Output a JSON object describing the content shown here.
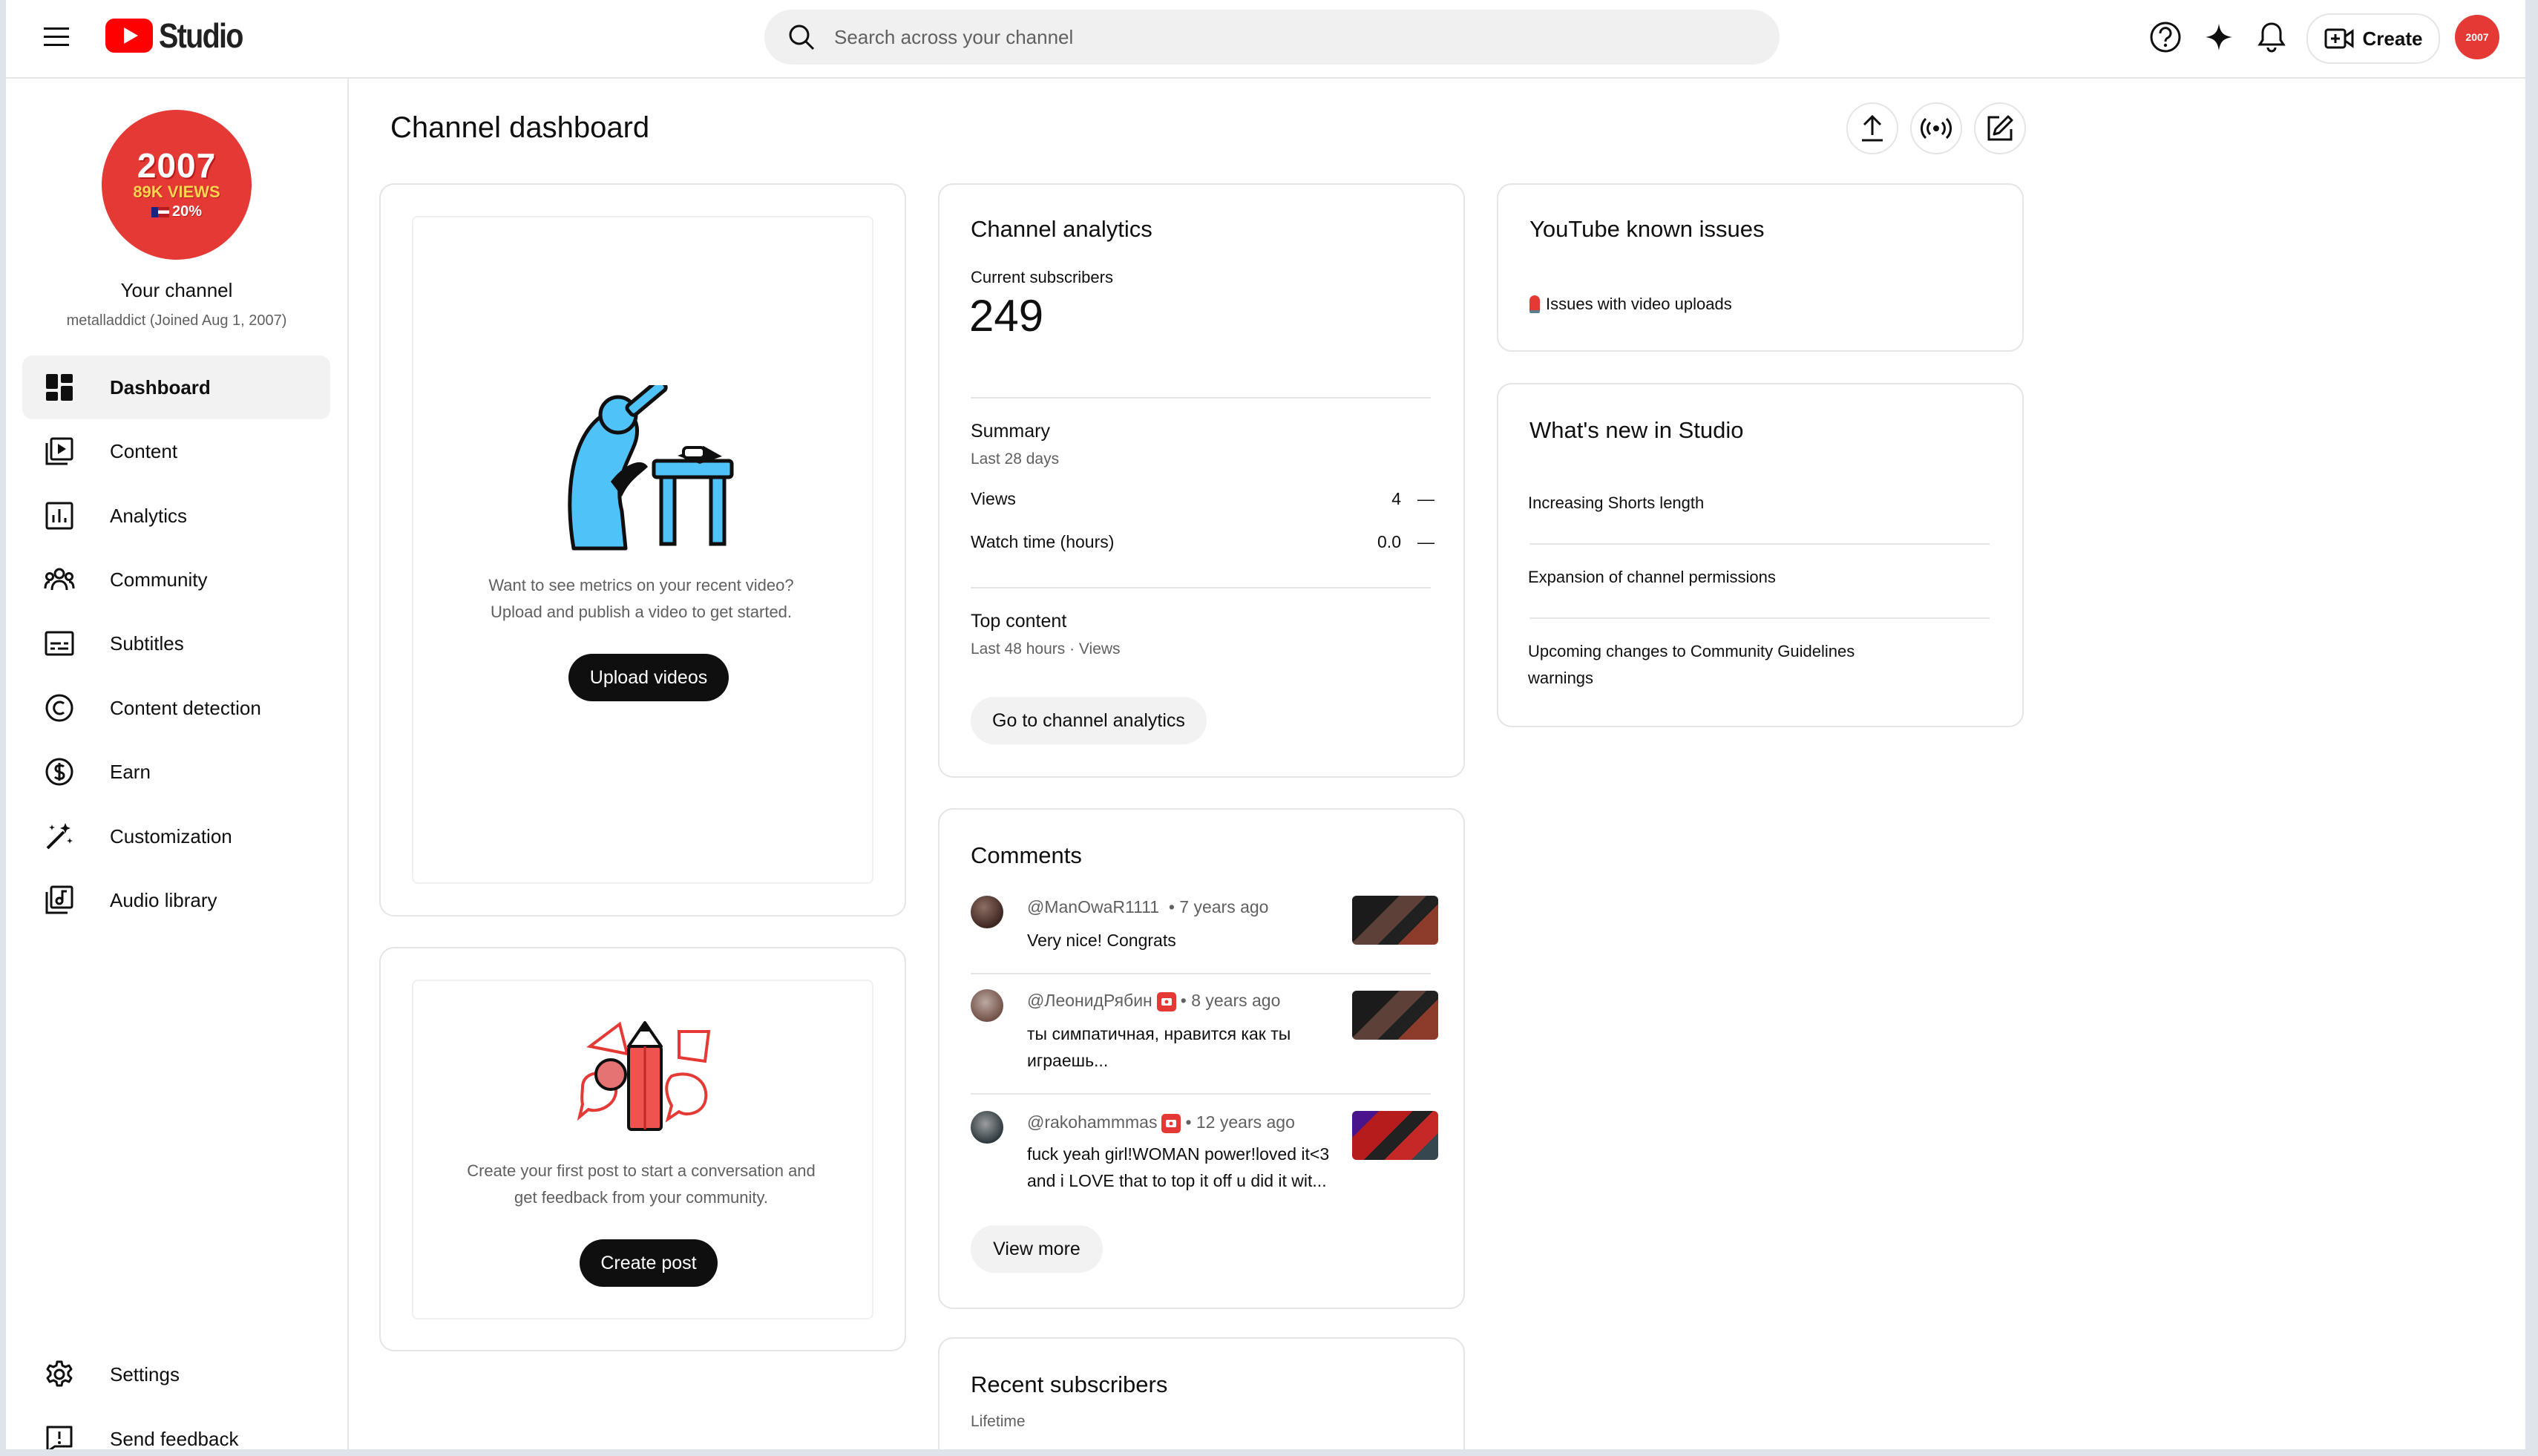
{
  "app": {
    "logo_text": "Studio",
    "search_placeholder": "Search across your channel",
    "create_label": "Create",
    "avatar_small_text": "2007"
  },
  "channel": {
    "avatar_year": "2007",
    "avatar_views": "89K VIEWS",
    "avatar_percent": "20%",
    "title": "Your channel",
    "subtitle": "metalladdict (Joined Aug 1, 2007)"
  },
  "sidebar": {
    "items": [
      {
        "label": "Dashboard",
        "icon": "dashboard-icon"
      },
      {
        "label": "Content",
        "icon": "content-icon"
      },
      {
        "label": "Analytics",
        "icon": "analytics-icon"
      },
      {
        "label": "Community",
        "icon": "community-icon"
      },
      {
        "label": "Subtitles",
        "icon": "subtitles-icon"
      },
      {
        "label": "Content detection",
        "icon": "copyright-icon"
      },
      {
        "label": "Earn",
        "icon": "dollar-icon"
      },
      {
        "label": "Customization",
        "icon": "magic-wand-icon"
      },
      {
        "label": "Audio library",
        "icon": "audio-library-icon"
      }
    ],
    "footer": [
      {
        "label": "Settings",
        "icon": "gear-icon"
      },
      {
        "label": "Send feedback",
        "icon": "feedback-icon"
      }
    ]
  },
  "main": {
    "title": "Channel dashboard",
    "video_card": {
      "text_line1": "Want to see metrics on your recent video?",
      "text_line2": "Upload and publish a video to get started.",
      "button": "Upload videos"
    },
    "post_card": {
      "text_line1": "Create your first post to start a conversation and",
      "text_line2": "get feedback from your community.",
      "button": "Create post"
    },
    "analytics": {
      "title": "Channel analytics",
      "subs_label": "Current subscribers",
      "subs_value": "249",
      "summary_title": "Summary",
      "summary_period": "Last 28 days",
      "rows": [
        {
          "label": "Views",
          "value": "4",
          "trend": "—"
        },
        {
          "label": "Watch time (hours)",
          "value": "0.0",
          "trend": "—"
        }
      ],
      "top_title": "Top content",
      "top_period": "Last 48 hours · Views",
      "button": "Go to channel analytics"
    },
    "comments": {
      "title": "Comments",
      "items": [
        {
          "author": "@ManOwaR1111",
          "time": "• 7 years ago",
          "text": "Very nice! Congrats",
          "badge": false
        },
        {
          "author": "@ЛеонидРябин",
          "time": "• 8 years ago",
          "text": "ты симпатичная, нравится как ты играешь...",
          "badge": true
        },
        {
          "author": "@rakohammmas",
          "time": "• 12 years ago",
          "text": "fuck yeah girl!WOMAN power!loved it<3 and i LOVE that to top it off u did it wit...",
          "badge": true
        }
      ],
      "button": "View more"
    },
    "recent_subs": {
      "title": "Recent subscribers",
      "period": "Lifetime"
    },
    "known_issues": {
      "title": "YouTube known issues",
      "item": "Issues with video uploads"
    },
    "whats_new": {
      "title": "What's new in Studio",
      "items": [
        "Increasing Shorts length",
        "Expansion of channel permissions",
        "Upcoming changes to Community Guidelines warnings"
      ]
    }
  },
  "colors": {
    "brand_red": "#ff0000",
    "avatar_red": "#e53935",
    "illustration_blue": "#4fc3f7",
    "text_primary": "#0f0f0f",
    "text_secondary": "#606060"
  }
}
